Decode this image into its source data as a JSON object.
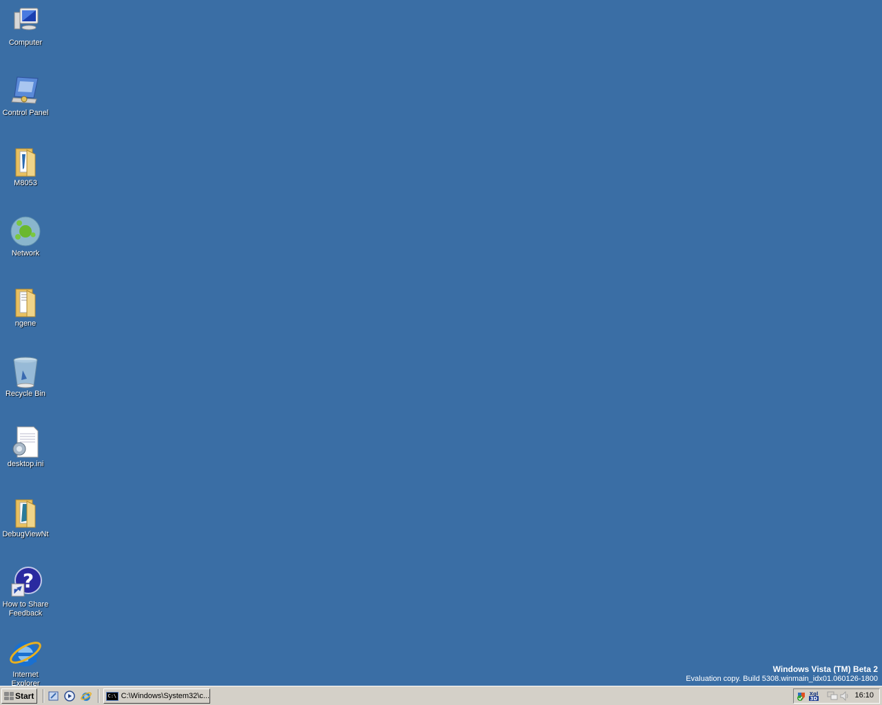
{
  "desktop": {
    "background_color": "#3a6ea5",
    "icons": [
      {
        "label": "Computer",
        "icon": "computer-icon"
      },
      {
        "label": "Control Panel",
        "icon": "control-panel-icon"
      },
      {
        "label": "M8053",
        "icon": "folder-icon"
      },
      {
        "label": "Network",
        "icon": "network-icon"
      },
      {
        "label": "ngene",
        "icon": "folder-icon"
      },
      {
        "label": "Recycle Bin",
        "icon": "recycle-bin-icon"
      },
      {
        "label": "desktop.ini",
        "icon": "settings-file-icon"
      },
      {
        "label": "DebugViewNt",
        "icon": "folder-icon"
      },
      {
        "label": "How to Share Feedback",
        "icon": "help-shortcut-icon"
      },
      {
        "label": "Internet Explorer",
        "icon": "internet-explorer-icon"
      }
    ],
    "watermark": {
      "title": "Windows Vista (TM) Beta 2",
      "build": "Evaluation copy. Build 5308.winmain_idx01.060126-1800"
    }
  },
  "taskbar": {
    "start_label": "Start",
    "quick_launch": [
      "show-desktop-icon",
      "media-player-icon",
      "internet-explorer-icon"
    ],
    "tasks": [
      {
        "label": "C:\\Windows\\System32\\c...",
        "icon": "command-prompt-icon",
        "icon_text": "C:\\"
      }
    ],
    "tray": {
      "icons": [
        "security-center-icon",
        "xgl-3d-icon",
        "network-status-icon",
        "volume-icon"
      ],
      "xgl_text_top": "Xgl",
      "xgl_text_bottom": "3D",
      "clock": "16:10"
    }
  }
}
